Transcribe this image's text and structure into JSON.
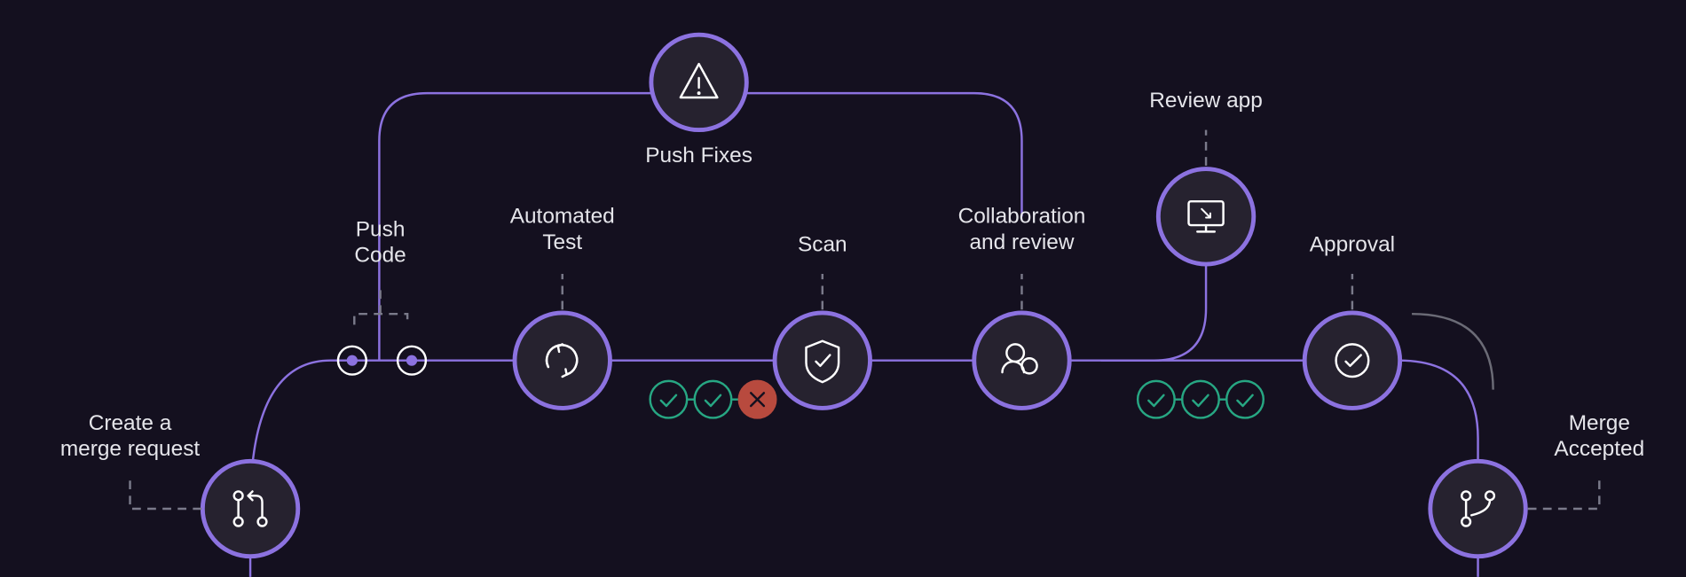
{
  "colors": {
    "bg": "#14101f",
    "accent": "#8c72e0",
    "node_fill": "#26222f",
    "node_stroke": "#8c72e0",
    "text": "#e5e5ea",
    "dashed": "#7a7a8a",
    "green": "#27a783",
    "red_fill": "#b84a3e",
    "white": "#ffffff"
  },
  "labels": {
    "create_mr": "Create a\nmerge request",
    "push_code": "Push\nCode",
    "automated_test": "Automated\nTest",
    "scan": "Scan",
    "collab": "Collaboration\nand review",
    "push_fixes": "Push Fixes",
    "review_app": "Review app",
    "approval": "Approval",
    "merge_accepted": "Merge\nAccepted"
  },
  "status_groups": {
    "test_results": [
      "pass",
      "pass",
      "fail"
    ],
    "review_results": [
      "pass",
      "pass",
      "pass"
    ]
  },
  "icons": {
    "create_mr": "merge-request-icon",
    "push_code": "commit-icon",
    "automated_test": "cycle-icon",
    "scan": "shield-icon",
    "collab": "people-icon",
    "push_fixes": "warning-icon",
    "review_app": "monitor-icon",
    "approval": "check-circle-icon",
    "merge_accepted": "branch-icon"
  }
}
